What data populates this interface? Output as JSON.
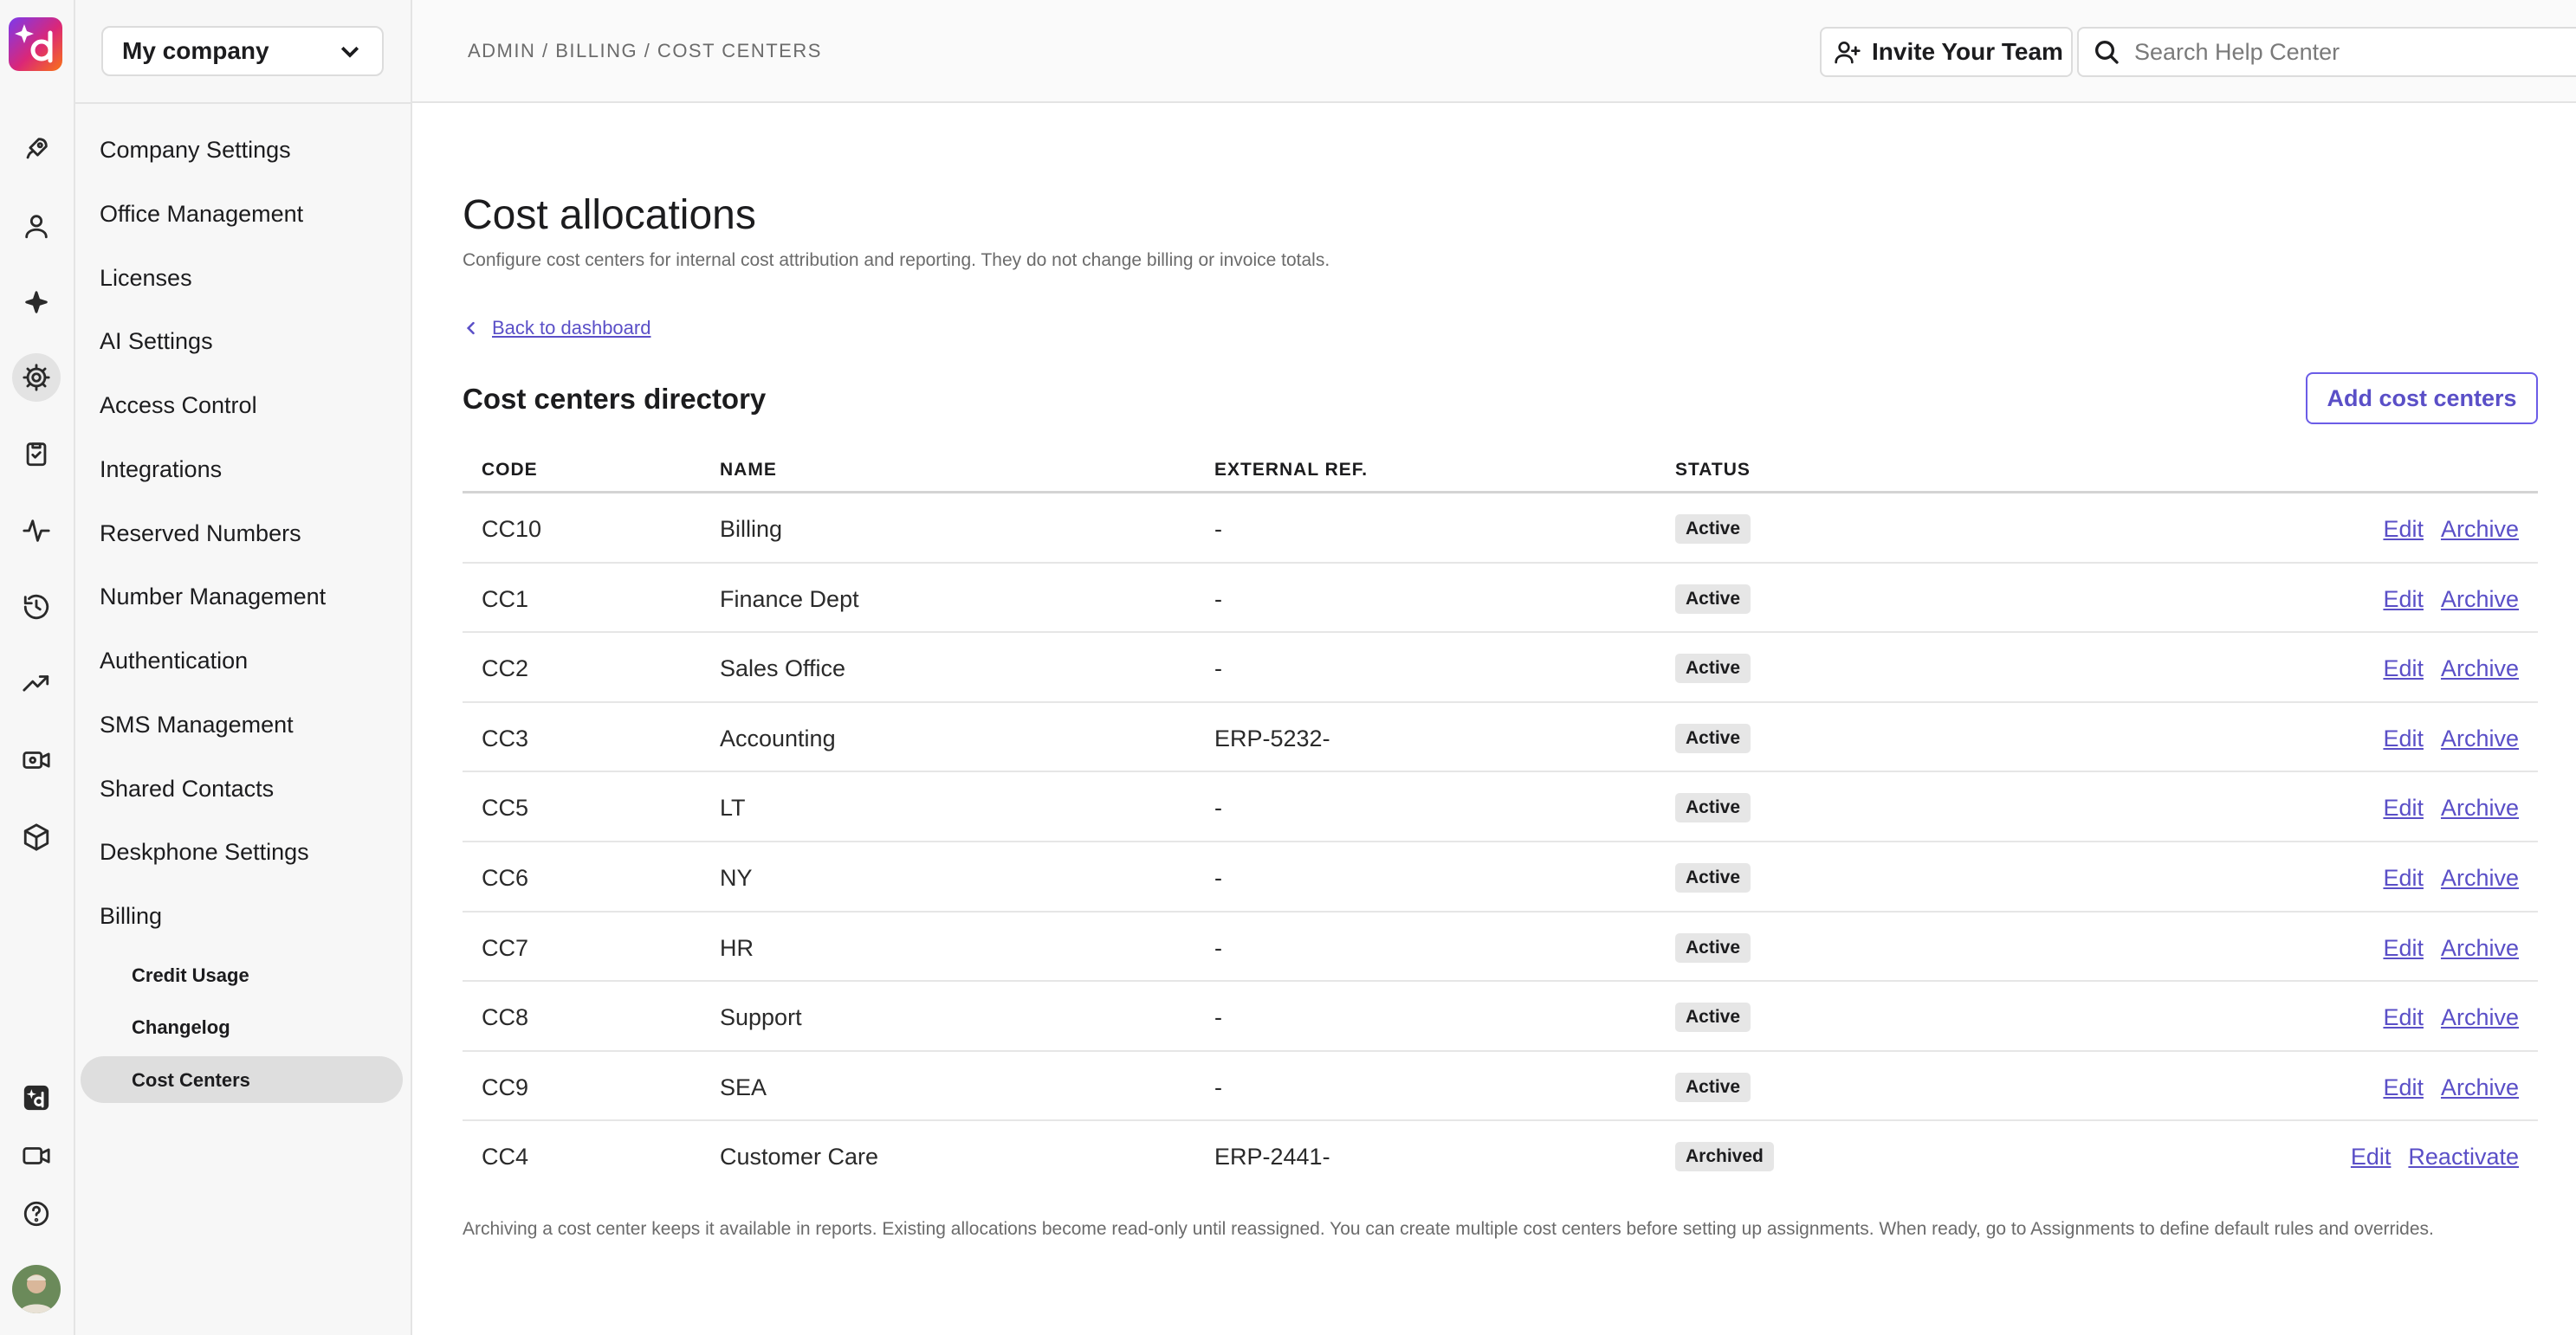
{
  "rail": {
    "items": [
      {
        "icon": "rocket-icon"
      },
      {
        "icon": "user-icon"
      },
      {
        "icon": "sparkle-icon"
      },
      {
        "icon": "gear-icon"
      },
      {
        "icon": "clipboard-icon"
      },
      {
        "icon": "activity-icon"
      },
      {
        "icon": "history-icon"
      },
      {
        "icon": "trending-up-icon"
      },
      {
        "icon": "video-settings-icon"
      },
      {
        "icon": "box-icon"
      }
    ],
    "bottom_items": [
      {
        "icon": "app-logo-icon"
      },
      {
        "icon": "video-icon"
      },
      {
        "icon": "help-icon"
      }
    ]
  },
  "sidebar": {
    "company": "My company",
    "items": [
      {
        "label": "Company Settings"
      },
      {
        "label": "Office Management"
      },
      {
        "label": "Licenses"
      },
      {
        "label": "AI Settings"
      },
      {
        "label": "Access Control"
      },
      {
        "label": "Integrations"
      },
      {
        "label": "Reserved Numbers"
      },
      {
        "label": "Number Management"
      },
      {
        "label": "Authentication"
      },
      {
        "label": "SMS Management"
      },
      {
        "label": "Shared Contacts"
      },
      {
        "label": "Deskphone Settings"
      },
      {
        "label": "Billing"
      }
    ],
    "sub_items": [
      {
        "label": "Credit Usage"
      },
      {
        "label": "Changelog"
      },
      {
        "label": "Cost Centers"
      }
    ]
  },
  "header": {
    "breadcrumb": "ADMIN / BILLING / COST CENTERS",
    "invite_label": "Invite Your Team",
    "search_placeholder": "Search Help Center"
  },
  "main": {
    "title": "Cost allocations",
    "subtitle": "Configure cost centers for internal cost attribution and reporting. They do not change billing or invoice totals.",
    "back_label": "Back to dashboard",
    "section_title": "Cost centers directory",
    "add_button": "Add cost centers",
    "columns": {
      "code": "CODE",
      "name": "NAME",
      "ext": "EXTERNAL REF.",
      "status": "STATUS"
    },
    "rows": [
      {
        "code": "CC10",
        "name": "Billing",
        "ext": "-",
        "status": "Active",
        "a1": "Edit",
        "a2": "Archive"
      },
      {
        "code": "CC1",
        "name": "Finance Dept",
        "ext": "-",
        "status": "Active",
        "a1": "Edit",
        "a2": "Archive"
      },
      {
        "code": "CC2",
        "name": "Sales Office",
        "ext": "-",
        "status": "Active",
        "a1": "Edit",
        "a2": "Archive"
      },
      {
        "code": "CC3",
        "name": "Accounting",
        "ext": "ERP-5232-",
        "status": "Active",
        "a1": "Edit",
        "a2": "Archive"
      },
      {
        "code": "CC5",
        "name": "LT",
        "ext": "-",
        "status": "Active",
        "a1": "Edit",
        "a2": "Archive"
      },
      {
        "code": "CC6",
        "name": "NY",
        "ext": "-",
        "status": "Active",
        "a1": "Edit",
        "a2": "Archive"
      },
      {
        "code": "CC7",
        "name": "HR",
        "ext": "-",
        "status": "Active",
        "a1": "Edit",
        "a2": "Archive"
      },
      {
        "code": "CC8",
        "name": "Support",
        "ext": "-",
        "status": "Active",
        "a1": "Edit",
        "a2": "Archive"
      },
      {
        "code": "CC9",
        "name": "SEA",
        "ext": "-",
        "status": "Active",
        "a1": "Edit",
        "a2": "Archive"
      },
      {
        "code": "CC4",
        "name": "Customer Care",
        "ext": "ERP-2441-",
        "status": "Archived",
        "a1": "Edit",
        "a2": "Reactivate"
      }
    ],
    "footnote": "Archiving a cost center keeps it available in reports. Existing allocations become read-only until reassigned. You can create multiple cost centers before setting up assignments. When ready, go to Assignments to define default rules and overrides."
  },
  "colors": {
    "accent": "#5a4fc7",
    "badge_bg": "#e6e6e6",
    "sidebar_bg": "#f7f7f7"
  }
}
